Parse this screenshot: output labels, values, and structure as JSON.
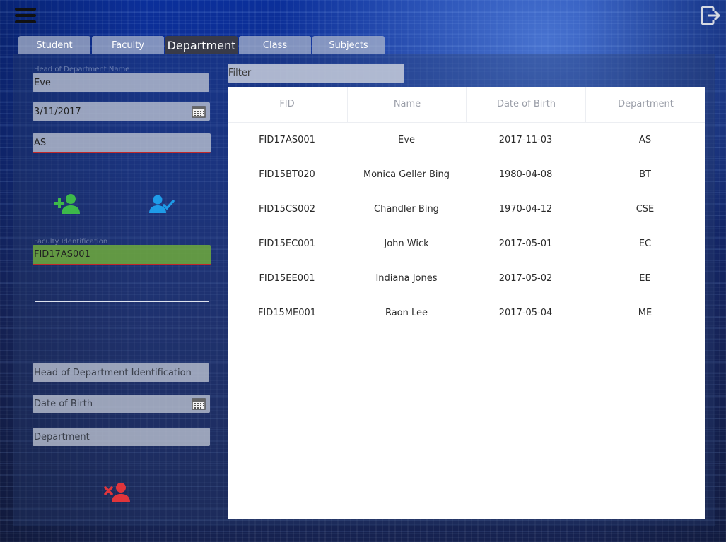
{
  "tabs": [
    {
      "label": "Student",
      "active": false
    },
    {
      "label": "Faculty",
      "active": false
    },
    {
      "label": "Department",
      "active": true
    },
    {
      "label": "Class",
      "active": false
    },
    {
      "label": "Subjects",
      "active": false
    }
  ],
  "form_top": {
    "hod_name_label": "Head of Department Name",
    "hod_name_value": "Eve",
    "date_value": "3/11/2017",
    "department_value": "AS",
    "faculty_id_label": "Faculty Identification",
    "faculty_id_value": "FID17AS001"
  },
  "form_bottom": {
    "hod_id_placeholder": "Head of Department Identification",
    "dob_placeholder": "Date of Birth",
    "department_placeholder": "Department"
  },
  "filter": {
    "placeholder": "Filter"
  },
  "table": {
    "headers": [
      "FID",
      "Name",
      "Date of Birth",
      "Department"
    ],
    "rows": [
      [
        "FID17AS001",
        "Eve",
        "2017-11-03",
        "AS"
      ],
      [
        "FID15BT020",
        "Monica Geller Bing",
        "1980-04-08",
        "BT"
      ],
      [
        "FID15CS002",
        "Chandler Bing",
        "1970-04-12",
        "CSE"
      ],
      [
        "FID15EC001",
        "John Wick",
        "2017-05-01",
        "EC"
      ],
      [
        "FID15EE001",
        "Indiana Jones",
        "2017-05-02",
        "EE"
      ],
      [
        "FID15ME001",
        "Raon Lee",
        "2017-05-04",
        "ME"
      ]
    ]
  },
  "icons": {
    "add_user": "add-user-icon",
    "verify_user": "user-check-icon",
    "remove_user": "remove-user-icon",
    "logout": "logout-icon",
    "menu": "hamburger-menu-icon",
    "calendar": "calendar-icon"
  },
  "colors": {
    "add_user": "#3db94a",
    "verify_user": "#1e9be8",
    "remove_user": "#e0353b",
    "active_tab": "#3c3c42",
    "faculty_id_field": "#6eaa3c",
    "error_underline": "#c0282a"
  }
}
